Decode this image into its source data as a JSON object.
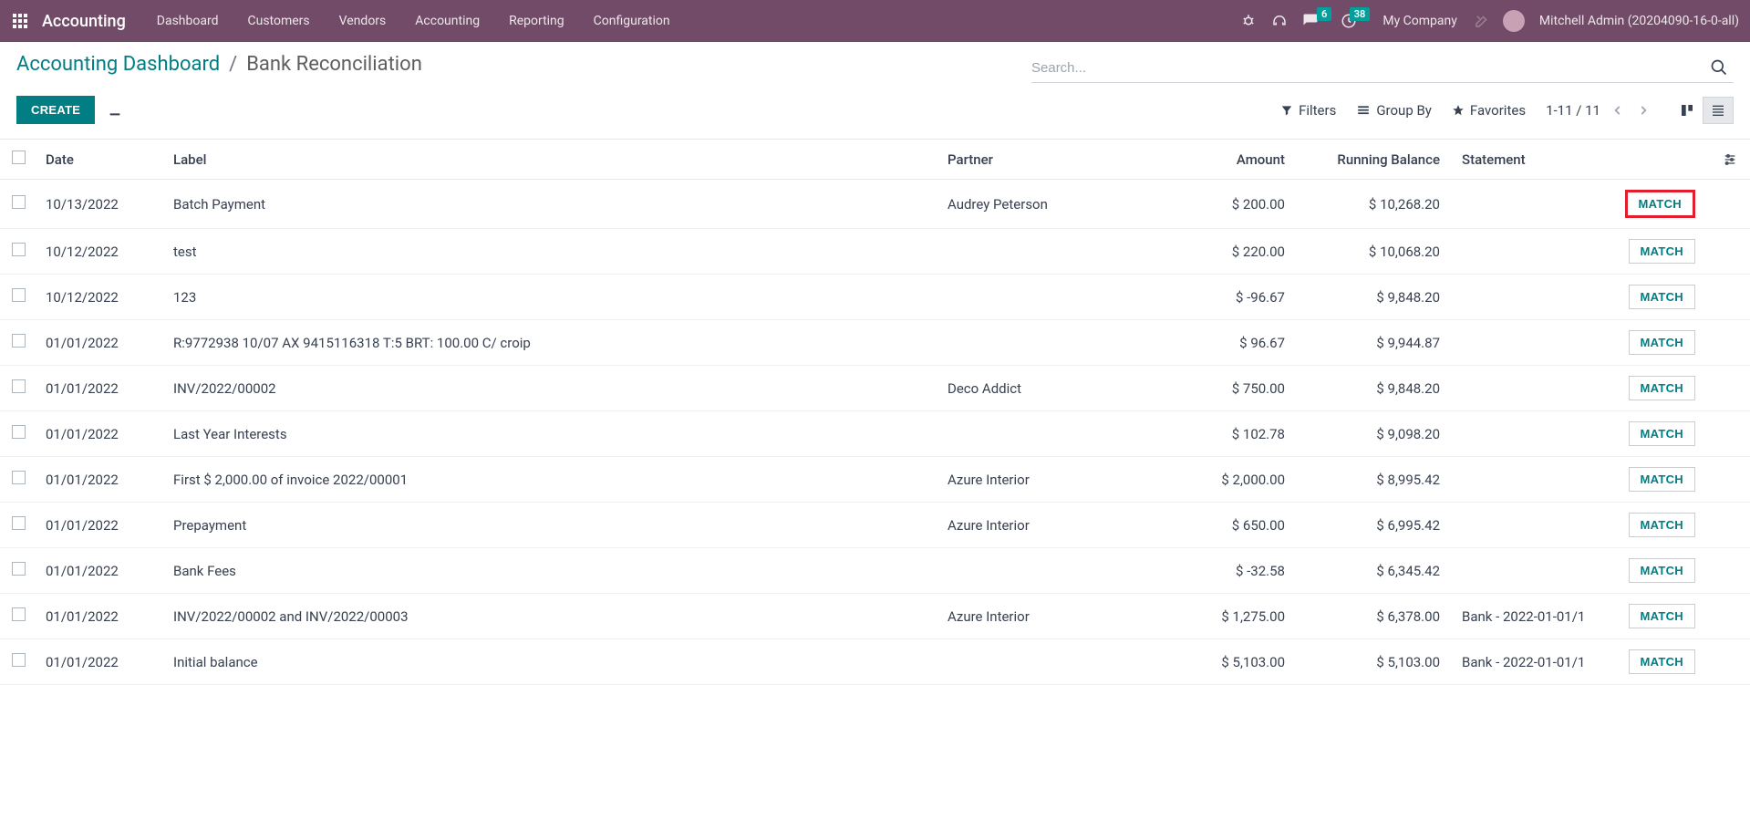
{
  "navbar": {
    "brand": "Accounting",
    "links": [
      "Dashboard",
      "Customers",
      "Vendors",
      "Accounting",
      "Reporting",
      "Configuration"
    ],
    "messages_badge": "6",
    "activities_badge": "38",
    "company": "My Company",
    "user": "Mitchell Admin (20204090-16-0-all)"
  },
  "breadcrumb": {
    "parent": "Accounting Dashboard",
    "current": "Bank Reconciliation"
  },
  "search": {
    "placeholder": "Search..."
  },
  "buttons": {
    "create": "CREATE",
    "filters": "Filters",
    "groupby": "Group By",
    "favorites": "Favorites",
    "match": "MATCH"
  },
  "pager": {
    "text": "1-11 / 11"
  },
  "columns": {
    "date": "Date",
    "label": "Label",
    "partner": "Partner",
    "amount": "Amount",
    "balance": "Running Balance",
    "statement": "Statement"
  },
  "rows": [
    {
      "date": "10/13/2022",
      "label": "Batch Payment",
      "partner": "Audrey Peterson",
      "amount": "$ 200.00",
      "balance": "$ 10,268.20",
      "statement": "",
      "highlight": true
    },
    {
      "date": "10/12/2022",
      "label": "test",
      "partner": "",
      "amount": "$ 220.00",
      "balance": "$ 10,068.20",
      "statement": ""
    },
    {
      "date": "10/12/2022",
      "label": "123",
      "partner": "",
      "amount": "$ -96.67",
      "balance": "$ 9,848.20",
      "statement": ""
    },
    {
      "date": "01/01/2022",
      "label": "R:9772938 10/07 AX 9415116318 T:5 BRT: 100.00 C/ croip",
      "partner": "",
      "amount": "$ 96.67",
      "balance": "$ 9,944.87",
      "statement": ""
    },
    {
      "date": "01/01/2022",
      "label": "INV/2022/00002",
      "partner": "Deco Addict",
      "amount": "$ 750.00",
      "balance": "$ 9,848.20",
      "statement": ""
    },
    {
      "date": "01/01/2022",
      "label": "Last Year Interests",
      "partner": "",
      "amount": "$ 102.78",
      "balance": "$ 9,098.20",
      "statement": ""
    },
    {
      "date": "01/01/2022",
      "label": "First $ 2,000.00 of invoice 2022/00001",
      "partner": "Azure Interior",
      "amount": "$ 2,000.00",
      "balance": "$ 8,995.42",
      "statement": ""
    },
    {
      "date": "01/01/2022",
      "label": "Prepayment",
      "partner": "Azure Interior",
      "amount": "$ 650.00",
      "balance": "$ 6,995.42",
      "statement": ""
    },
    {
      "date": "01/01/2022",
      "label": "Bank Fees",
      "partner": "",
      "amount": "$ -32.58",
      "balance": "$ 6,345.42",
      "statement": ""
    },
    {
      "date": "01/01/2022",
      "label": "INV/2022/00002 and INV/2022/00003",
      "partner": "Azure Interior",
      "amount": "$ 1,275.00",
      "balance": "$ 6,378.00",
      "statement": "Bank - 2022-01-01/1"
    },
    {
      "date": "01/01/2022",
      "label": "Initial balance",
      "partner": "",
      "amount": "$ 5,103.00",
      "balance": "$ 5,103.00",
      "statement": "Bank - 2022-01-01/1"
    }
  ]
}
